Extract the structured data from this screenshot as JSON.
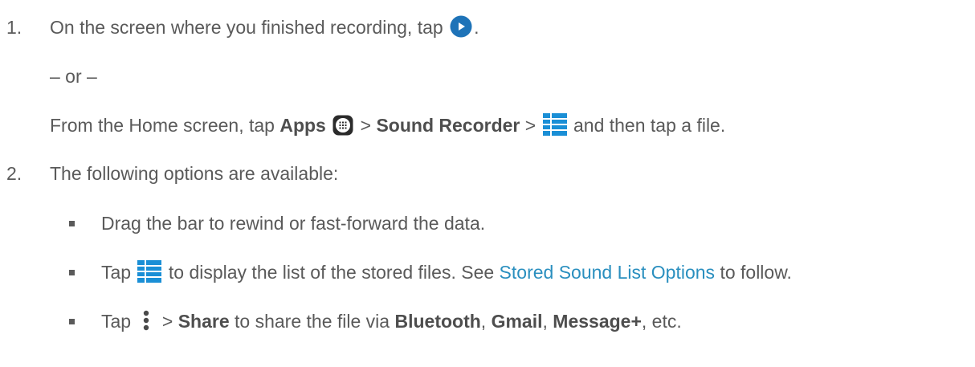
{
  "steps": [
    {
      "number": "1.",
      "text_before": "On the screen where you finished recording, tap",
      "play_icon": "play-icon",
      "text_after": ".",
      "or": "– or –",
      "alt_prefix": "From the Home screen, tap",
      "apps_label": "Apps",
      "apps_icon": "apps-icon",
      "sep1": ">",
      "sound_recorder_label": "Sound Recorder",
      "sep2": ">",
      "list_icon": "list-icon",
      "alt_suffix": "and then tap a file."
    },
    {
      "number": "2.",
      "text": "The following options are available:"
    }
  ],
  "bullets": [
    {
      "text": "Drag the bar to rewind or fast-forward the data."
    },
    {
      "prefix": "Tap",
      "icon": "list-icon",
      "middle": "to display the list of the stored files. See",
      "link": "Stored Sound List Options",
      "suffix": "to follow."
    },
    {
      "prefix": "Tap",
      "icon": "overflow-menu-icon",
      "sep": ">",
      "share": "Share",
      "middle": "to share the file via",
      "bluetooth": "Bluetooth",
      "comma1": ",",
      "gmail": "Gmail",
      "comma2": ",",
      "message": "Message+",
      "suffix": ", etc."
    }
  ],
  "colors": {
    "text": "#5a5a5a",
    "link": "#2a8fbf",
    "play_icon": "#1e73b8",
    "list_icon": "#1a8fd6"
  }
}
